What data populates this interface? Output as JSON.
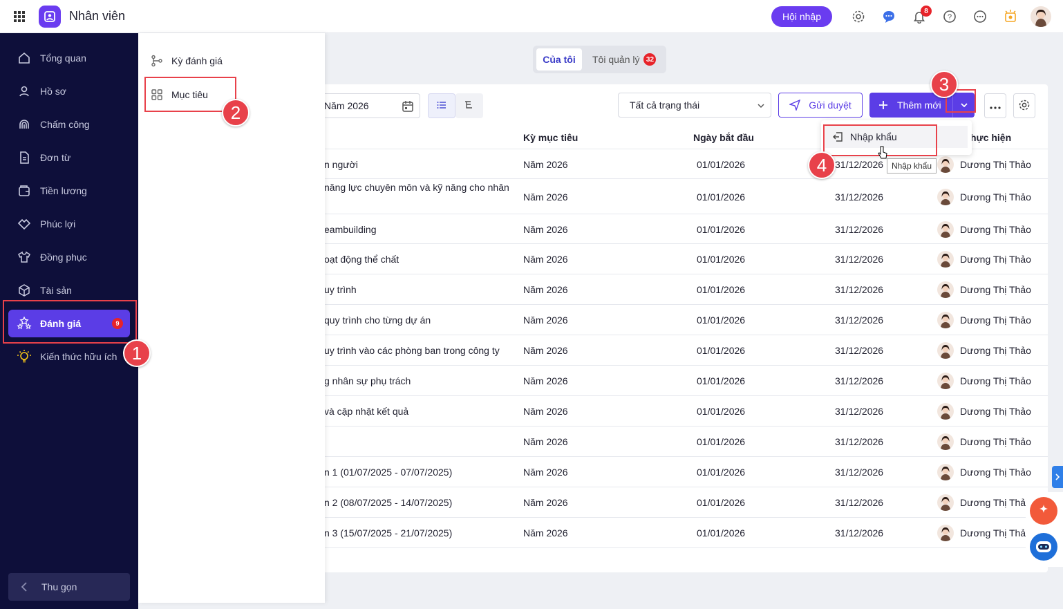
{
  "app": {
    "title": "Nhân viên",
    "join_label": "Hội nhập",
    "notification_count": "8"
  },
  "sidebar": {
    "items": [
      {
        "label": "Tổng quan",
        "icon": "home-icon"
      },
      {
        "label": "Hồ sơ",
        "icon": "user-icon"
      },
      {
        "label": "Chấm công",
        "icon": "fingerprint-icon"
      },
      {
        "label": "Đơn từ",
        "icon": "document-icon"
      },
      {
        "label": "Tiền lương",
        "icon": "wallet-icon"
      },
      {
        "label": "Phúc lợi",
        "icon": "handshake-icon"
      },
      {
        "label": "Đồng phục",
        "icon": "shirt-icon"
      },
      {
        "label": "Tài sản",
        "icon": "box-icon"
      },
      {
        "label": "Đánh giá",
        "icon": "stars-icon",
        "badge": "9"
      },
      {
        "label": "Kiến thức hữu ích",
        "icon": "lightbulb-icon"
      }
    ],
    "collapse_label": "Thu gọn"
  },
  "submenu": {
    "items": [
      {
        "label": "Kỳ đánh giá"
      },
      {
        "label": "Mục tiêu"
      }
    ]
  },
  "tabs": {
    "mine": "Của tôi",
    "managed": "Tôi quản lý",
    "managed_count": "32"
  },
  "toolbar": {
    "period_value": "Năm 2026",
    "status_value": "Tất cả trạng thái",
    "send_label": "Gửi duyệt",
    "add_label": "Thêm mới"
  },
  "dropdown": {
    "import_label": "Nhập khẩu",
    "tooltip": "Nhập khẩu"
  },
  "table": {
    "headers": {
      "period": "Kỳ mục tiêu",
      "start": "Ngày bắt đầu",
      "assignee": "hực hiện"
    },
    "rows": [
      {
        "name": "n người",
        "period": "Năm 2026",
        "start": "01/01/2026",
        "end": "31/12/2026",
        "assignee": "Dương Thị Thảo"
      },
      {
        "name": "năng lực chuyên môn và kỹ năng cho nhân",
        "period": "Năm 2026",
        "start": "01/01/2026",
        "end": "31/12/2026",
        "assignee": "Dương Thị Thảo"
      },
      {
        "name": "eambuilding",
        "period": "Năm 2026",
        "start": "01/01/2026",
        "end": "31/12/2026",
        "assignee": "Dương Thị Thảo"
      },
      {
        "name": "oạt động thể chất",
        "period": "Năm 2026",
        "start": "01/01/2026",
        "end": "31/12/2026",
        "assignee": "Dương Thị Thảo"
      },
      {
        "name": "uy trình",
        "period": "Năm 2026",
        "start": "01/01/2026",
        "end": "31/12/2026",
        "assignee": "Dương Thị Thảo"
      },
      {
        "name": "quy trình cho từng dự án",
        "period": "Năm 2026",
        "start": "01/01/2026",
        "end": "31/12/2026",
        "assignee": "Dương Thị Thảo"
      },
      {
        "name": "uy trình vào các phòng ban trong công ty",
        "period": "Năm 2026",
        "start": "01/01/2026",
        "end": "31/12/2026",
        "assignee": "Dương Thị Thảo"
      },
      {
        "name": "g nhân sự phụ trách",
        "period": "Năm 2026",
        "start": "01/01/2026",
        "end": "31/12/2026",
        "assignee": "Dương Thị Thảo"
      },
      {
        "name": "và cập nhật kết quả",
        "period": "Năm 2026",
        "start": "01/01/2026",
        "end": "31/12/2026",
        "assignee": "Dương Thị Thảo"
      },
      {
        "name": "",
        "period": "Năm 2026",
        "start": "01/01/2026",
        "end": "31/12/2026",
        "assignee": "Dương Thị Thảo"
      },
      {
        "name": "n 1 (01/07/2025 - 07/07/2025)",
        "period": "Năm 2026",
        "start": "01/01/2026",
        "end": "31/12/2026",
        "assignee": "Dương Thị Thảo"
      },
      {
        "name": "n 2 (08/07/2025 - 14/07/2025)",
        "period": "Năm 2026",
        "start": "01/01/2026",
        "end": "31/12/2026",
        "assignee": "Dương Thị Thả"
      },
      {
        "name": "n 3 (15/07/2025 - 21/07/2025)",
        "period": "Năm 2026",
        "start": "01/01/2026",
        "end": "31/12/2026",
        "assignee": "Dương Thị Thả"
      }
    ]
  },
  "annotations": {
    "step1": "1",
    "step2": "2",
    "step3": "3",
    "step4": "4"
  },
  "colors": {
    "accent": "#5b3de6",
    "sidebar_bg": "#0e0f3a",
    "highlight": "#e8414a"
  }
}
